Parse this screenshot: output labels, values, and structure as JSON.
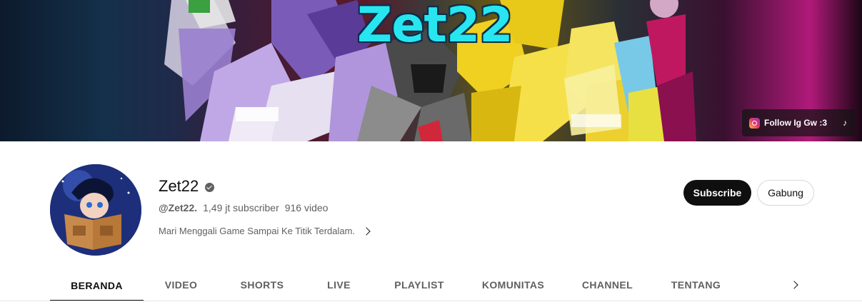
{
  "banner": {
    "title": "Zet22",
    "link_label": "Follow Ig Gw :3",
    "link_icon": "instagram-icon",
    "extra_icon": "tiktok-icon",
    "tiktok_glyph": "♪"
  },
  "channel": {
    "name": "Zet22",
    "verified_icon": "verified-check-icon",
    "handle": "@Zet22.",
    "subscribers": "1,49 jt subscriber",
    "videos": "916 video",
    "description": "Mari Menggali Game Sampai Ke Titik Terdalam.",
    "subscribe_label": "Subscribe",
    "join_label": "Gabung"
  },
  "tabs": [
    {
      "label": "BERANDA",
      "active": true
    },
    {
      "label": "VIDEO",
      "active": false
    },
    {
      "label": "SHORTS",
      "active": false
    },
    {
      "label": "LIVE",
      "active": false
    },
    {
      "label": "PLAYLIST",
      "active": false
    },
    {
      "label": "KOMUNITAS",
      "active": false
    },
    {
      "label": "CHANNEL",
      "active": false
    },
    {
      "label": "TENTANG",
      "active": false
    }
  ],
  "colors": {
    "subscribe_bg": "#0f0f0f",
    "banner_title": "#27e6f0"
  }
}
